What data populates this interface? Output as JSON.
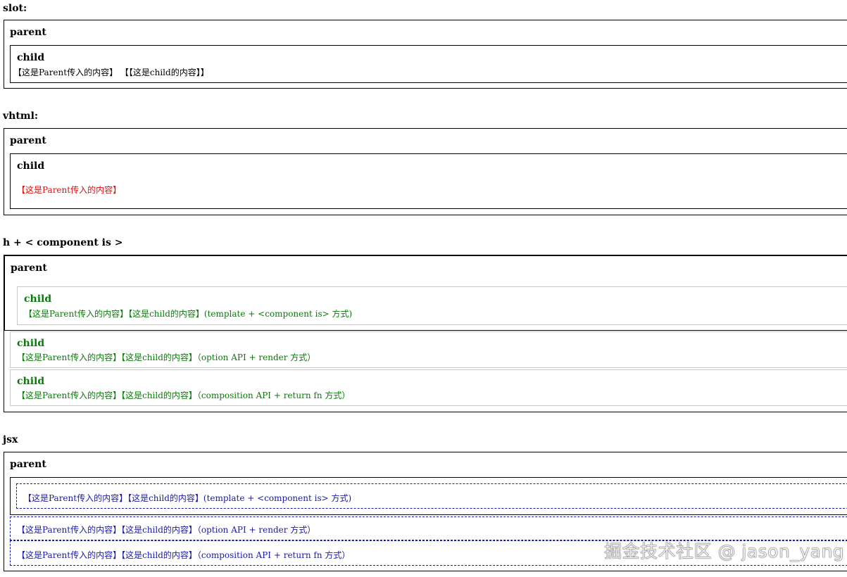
{
  "sections": {
    "slot": {
      "title": "slot:",
      "parent_label": "parent",
      "child_label": "child",
      "child_text": "【这是Parent传入的内容】 【【这是child的内容】】"
    },
    "vhtml": {
      "title": "vhtml:",
      "parent_label": "parent",
      "child_label": "child",
      "child_text": "【这是Parent传入的内容】"
    },
    "h_component": {
      "title": "h + < component is >",
      "parent_label": "parent",
      "child1_label": "child",
      "child1_text": "【这是Parent传入的内容】【这是child的内容】(template + <component is> 方式)",
      "child2_label": "child",
      "child2_text": "【这是Parent传入的内容】【这是child的内容】（option API + render 方式）",
      "child3_label": "child",
      "child3_text": "【这是Parent传入的内容】【这是child的内容】（composition API + return fn 方式）"
    },
    "jsx": {
      "title": "jsx",
      "parent_label": "parent",
      "child1_text": "【这是Parent传入的内容】【这是child的内容】(template + <component is> 方式)",
      "child2_text": "【这是Parent传入的内容】【这是child的内容】（option API + render 方式）",
      "child3_text": "【这是Parent传入的内容】【这是child的内容】（composition API + return fn 方式）"
    }
  },
  "watermark": "掘金技术社区 @ jason_yang",
  "colors": {
    "red": "#dd1111",
    "green": "#0a7a0a",
    "blue": "#1a1aa8"
  }
}
